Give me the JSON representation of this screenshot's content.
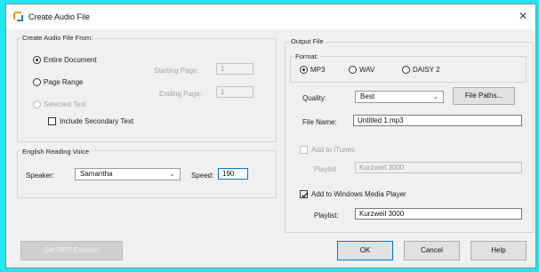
{
  "window": {
    "title": "Create Audio File",
    "close_glyph": "✕"
  },
  "source_group": {
    "label": "Create Audio File From:",
    "entire_document": "Entire Document",
    "page_range": "Page Range",
    "selected_text": "Selected Text",
    "include_secondary": "Include Secondary Text",
    "starting_page_label": "Starting Page:",
    "starting_page_value": "1",
    "ending_page_label": "Ending Page:",
    "ending_page_value": "1",
    "selected_option": "Entire Document",
    "include_secondary_checked": false
  },
  "voice_group": {
    "label": "English Reading Voice",
    "speaker_label": "Speaker:",
    "speaker_value": "Samantha",
    "speed_label": "Speed:",
    "speed_value": "190",
    "chevron_icon": "chevron-down-icon"
  },
  "output_group": {
    "label": "Output File",
    "format_label": "Format:",
    "formats": [
      "MP3",
      "WAV",
      "DAISY 2"
    ],
    "selected_format": "MP3",
    "quality_label": "Quality:",
    "quality_value": "Best",
    "file_paths_button": "File Paths...",
    "file_name_label": "File Name:",
    "file_name_value": "Untitled 1.mp3",
    "add_itunes_label": "Add to iTunes",
    "itunes_playlist_label": "Playlist",
    "itunes_playlist_value": "Kurzweil 3000",
    "add_itunes_checked": false,
    "add_wmp_label": "Add to Windows Media Player",
    "add_wmp_checked": true,
    "wmp_playlist_label": "Playlist:",
    "wmp_playlist_value": "Kurzweil 3000"
  },
  "buttons": {
    "encoder": "Get MP3 Encoder",
    "ok": "OK",
    "cancel": "Cancel",
    "help": "Help"
  },
  "colors": {
    "background": "#22e6f0",
    "dialog": "#f0f0f0",
    "default_button_border": "#0078d7",
    "icon_orange": "#f39c12",
    "icon_blue": "#2d7dd2"
  }
}
